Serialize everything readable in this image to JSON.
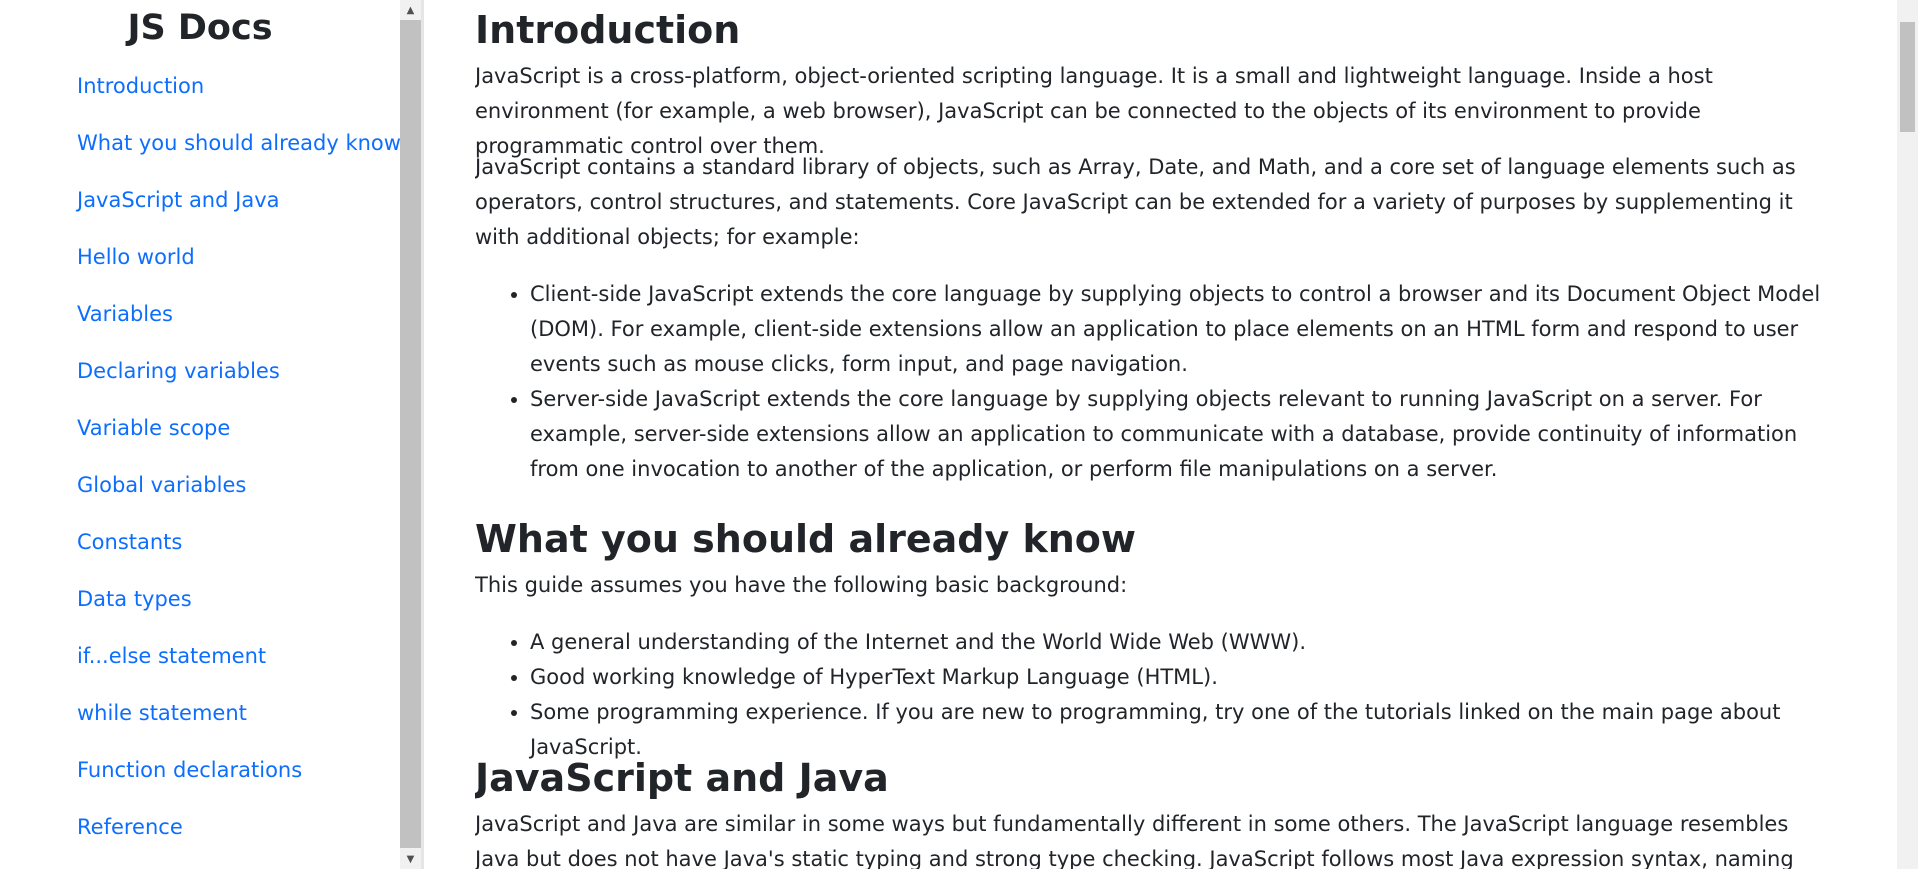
{
  "sidebar": {
    "title": "JS Docs",
    "items": [
      {
        "label": "Introduction"
      },
      {
        "label": "What you should already know"
      },
      {
        "label": "JavaScript and Java"
      },
      {
        "label": "Hello world"
      },
      {
        "label": "Variables"
      },
      {
        "label": "Declaring variables"
      },
      {
        "label": "Variable scope"
      },
      {
        "label": "Global variables"
      },
      {
        "label": "Constants"
      },
      {
        "label": "Data types"
      },
      {
        "label": "if...else statement"
      },
      {
        "label": "while statement"
      },
      {
        "label": "Function declarations"
      },
      {
        "label": "Reference"
      }
    ]
  },
  "main": {
    "sections": [
      {
        "heading": "Introduction",
        "paragraphs": [
          "JavaScript is a cross-platform, object-oriented scripting language. It is a small and lightweight language. Inside a host environment (for example, a web browser), JavaScript can be connected to the objects of its environment to provide programmatic control over them.",
          "JavaScript contains a standard library of objects, such as Array, Date, and Math, and a core set of language elements such as operators, control structures, and statements. Core JavaScript can be extended for a variety of purposes by supplementing it with additional objects; for example:"
        ],
        "list": [
          "Client-side JavaScript extends the core language by supplying objects to control a browser and its Document Object Model (DOM). For example, client-side extensions allow an application to place elements on an HTML form and respond to user events such as mouse clicks, form input, and page navigation.",
          "Server-side JavaScript extends the core language by supplying objects relevant to running JavaScript on a server. For example, server-side extensions allow an application to communicate with a database, provide continuity of information from one invocation to another of the application, or perform file manipulations on a server."
        ]
      },
      {
        "heading": "What you should already know",
        "paragraphs": [
          "This guide assumes you have the following basic background:"
        ],
        "list": [
          "A general understanding of the Internet and the World Wide Web (WWW).",
          "Good working knowledge of HyperText Markup Language (HTML).",
          "Some programming experience. If you are new to programming, try one of the tutorials linked on the main page about JavaScript."
        ]
      },
      {
        "heading": "JavaScript and Java",
        "paragraphs": [
          "JavaScript and Java are similar in some ways but fundamentally different in some others. The JavaScript language resembles Java but does not have Java's static typing and strong type checking. JavaScript follows most Java expression syntax, naming conventions and basic"
        ]
      }
    ]
  },
  "colors": {
    "link": "#0d6efd",
    "text": "#212529",
    "scrollbar_thumb": "#c1c1c1",
    "scrollbar_track": "#f1f1f1"
  }
}
